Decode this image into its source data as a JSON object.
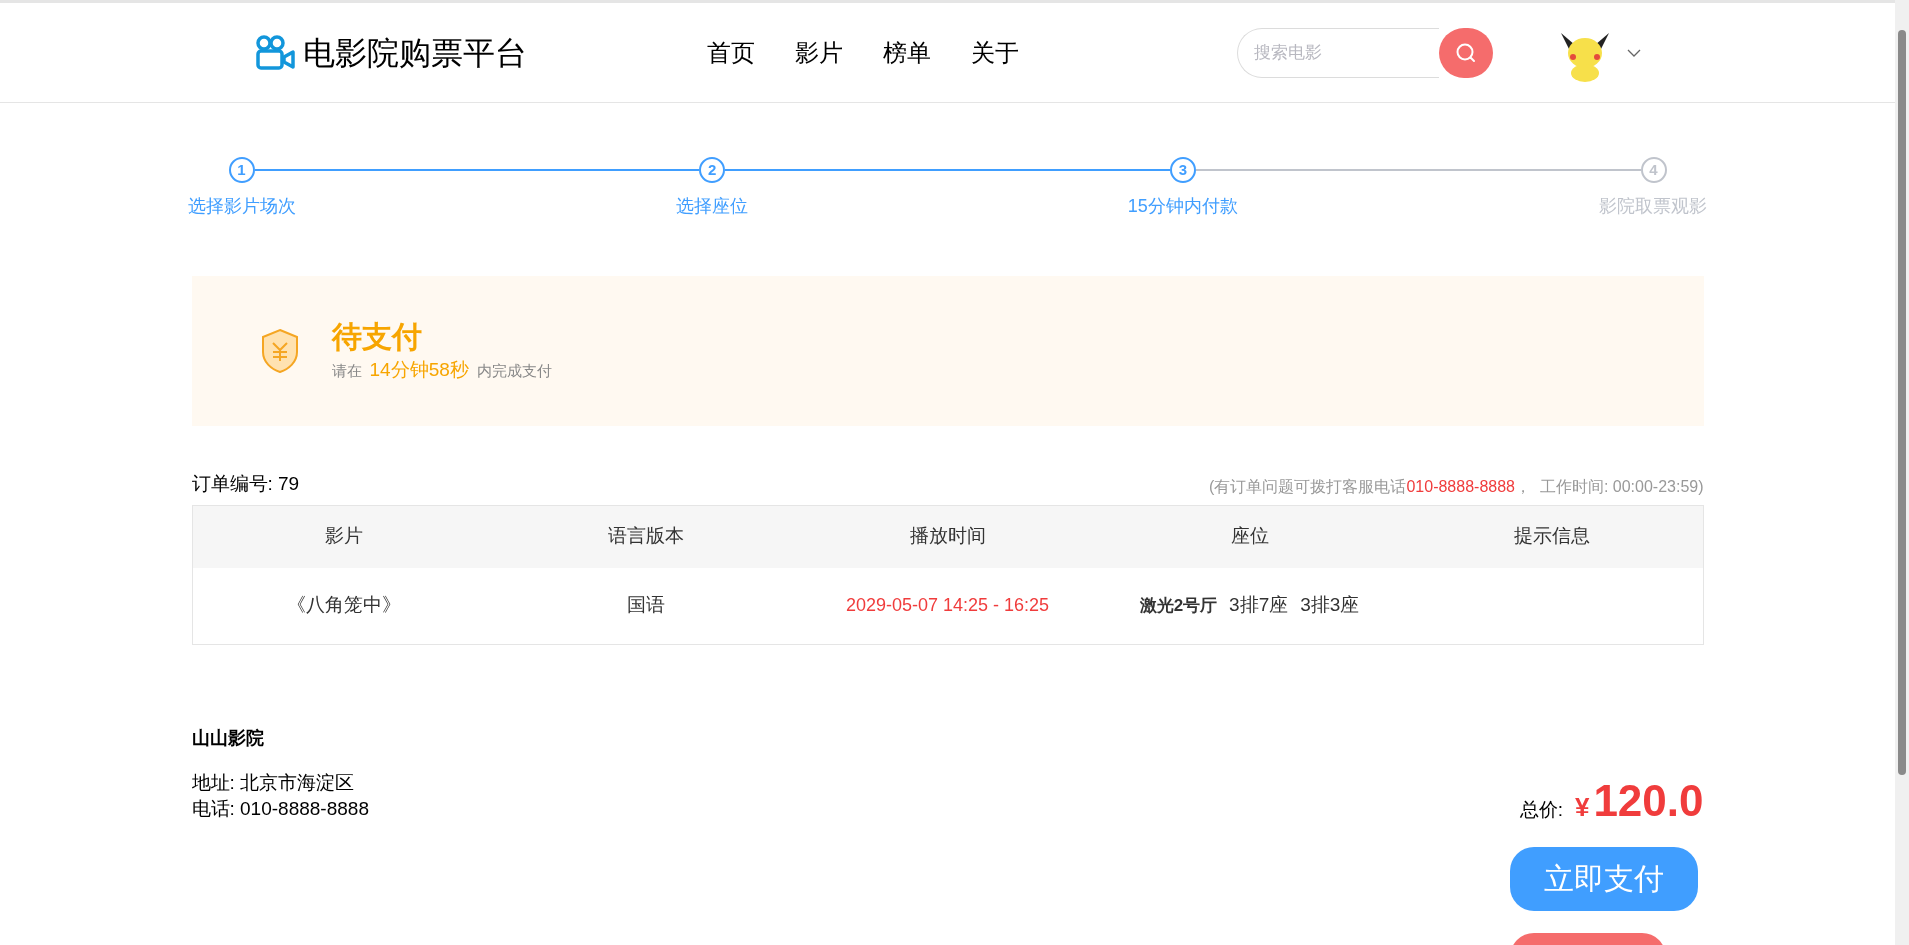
{
  "header": {
    "logo": "电影院购票平台",
    "nav": [
      "首页",
      "影片",
      "榜单",
      "关于"
    ],
    "search": {
      "placeholder": "搜索电影"
    }
  },
  "steps": [
    {
      "number": "1",
      "label": "选择影片场次",
      "done": true
    },
    {
      "number": "2",
      "label": "选择座位",
      "done": true
    },
    {
      "number": "3",
      "label": "15分钟内付款",
      "done": true
    },
    {
      "number": "4",
      "label": "影院取票观影",
      "done": false
    }
  ],
  "status": {
    "title": "待支付",
    "prefix": "请在",
    "countdown": "14分钟58秒",
    "suffix": "内完成支付"
  },
  "order": {
    "number_label": "订单编号: 79",
    "help_prefix": "(有订单问题可拨打客服电话",
    "help_phone": "010-8888-8888",
    "help_suffix": "，  工作时间: 00:00-23:59)"
  },
  "table": {
    "columns": [
      "影片",
      "语言版本",
      "播放时间",
      "座位",
      "提示信息"
    ],
    "rows": [
      {
        "movie": "《八角笼中》",
        "language": "国语",
        "time": "2029-05-07 14:25 - 16:25",
        "hall": "激光2号厅",
        "seats": [
          "3排7座",
          "3排3座"
        ]
      }
    ]
  },
  "cinema": {
    "name": "山山影院",
    "address": "地址: 北京市海淀区",
    "phone": "电话: 010-8888-8888"
  },
  "total": {
    "label": "总价:",
    "currency": "¥",
    "amount": "120.0"
  },
  "buttons": [
    {
      "label": "立即支付",
      "kind": "primary"
    },
    {
      "kind": "danger"
    }
  ]
}
